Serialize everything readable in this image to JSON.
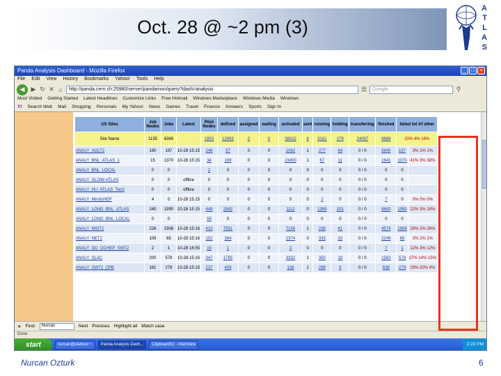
{
  "slide": {
    "title": "Oct. 28 @ ~2 pm (3)",
    "footer": "Nurcan Ozturk",
    "page_number": "6",
    "logo_letters": [
      "A",
      "T",
      "L",
      "A",
      "S"
    ]
  },
  "browser": {
    "window_title": "Panda Analysis Dashboard - Mozilla Firefox",
    "menu": [
      "File",
      "Edit",
      "View",
      "History",
      "Bookmarks",
      "Yahoo!",
      "Tools",
      "Help"
    ],
    "url": "http://panda.cern.ch:25980/server/pandamon/query?dash=analysis",
    "search_placeholder": "Google",
    "bookmarks": [
      "Most Visited",
      "Getting Started",
      "Latest Headlines",
      "Customize Links",
      "Free Hotmail",
      "Windows Marketplace",
      "Windows Media",
      "Windows"
    ],
    "yahoo_toolbar": [
      "Y!",
      "Search Web",
      "Mail",
      "Shopping",
      "Personals",
      "My Yahoo!",
      "News",
      "Games",
      "Travel",
      "Finance",
      "Answers",
      "Sports",
      "Sign In"
    ]
  },
  "table": {
    "headers": [
      "US Sites",
      "Job Nodes",
      "Jobs",
      "Latest",
      "Pilot Nodes",
      "defined",
      "assigned",
      "waiting",
      "activated",
      "sent",
      "running",
      "holding",
      "transferring",
      "finished",
      "failed tot trf other"
    ],
    "summary": [
      "Site Name",
      "1135",
      "6386",
      "",
      "1993",
      "12963",
      "0",
      "0",
      "38622",
      "6",
      "3161",
      "279",
      "24087",
      "8686",
      "20% 4% 16%"
    ],
    "rows": [
      [
        "ANALY_AGLT2",
        "160",
        "197",
        "10-28 15:15",
        "248",
        "57",
        "0",
        "0",
        "1062",
        "1",
        "277",
        "64",
        "0 / 0",
        "5640",
        "197",
        "3% 1% 1%"
      ],
      [
        "ANALY_BNL_ATLAS_1",
        "15",
        "1370",
        "10-28 15:15",
        "34",
        "199",
        "0",
        "0",
        "23400",
        "1",
        "67",
        "11",
        "0 / 0",
        "1641",
        "1070",
        "41% 3% 38%"
      ],
      [
        "ANALY_BNL_LOCAL",
        "0",
        "0",
        "",
        "2",
        "0",
        "0",
        "0",
        "0",
        "0",
        "0",
        "0",
        "0 / 0",
        "0",
        "0",
        ""
      ],
      [
        "ANALY_GLOW-ATLAS",
        "0",
        "0",
        "offline",
        "0",
        "0",
        "0",
        "0",
        "0",
        "0",
        "0",
        "0",
        "0 / 0",
        "0",
        "0",
        ""
      ],
      [
        "ANALY_HU_ATLAS_Tier2",
        "0",
        "0",
        "offline",
        "0",
        "0",
        "0",
        "0",
        "0",
        "0",
        "0",
        "0",
        "0 / 0",
        "0",
        "0",
        ""
      ],
      [
        "ANALY_IllinoisHEP",
        "4",
        "0",
        "10-28 15:15",
        "0",
        "0",
        "0",
        "0",
        "0",
        "0",
        "2",
        "0",
        "0 / 0",
        "7",
        "0",
        "0% 0% 0%"
      ],
      [
        "ANALY_LONG_BNL_ATLAS",
        "240",
        "1990",
        "10-28 15:15",
        "445",
        "2582",
        "0",
        "0",
        "1112",
        "0",
        "1385",
        "201",
        "0 / 0",
        "8600",
        "1990",
        "22% 3% 19%"
      ],
      [
        "ANALY_LONG_BNL_LOCAL",
        "0",
        "0",
        "",
        "59",
        "0",
        "0",
        "0",
        "0",
        "0",
        "0",
        "0",
        "0 / 0",
        "0",
        "0",
        ""
      ],
      [
        "ANALY_MWT2",
        "226",
        "1908",
        "10-28 15:16",
        "415",
        "7551",
        "0",
        "0",
        "7156",
        "1",
        "236",
        "41",
        "0 / 0",
        "4574",
        "1908",
        "29% 2% 26%"
      ],
      [
        "ANALY_NET2",
        "109",
        "65",
        "10-28 15:16",
        "152",
        "384",
        "0",
        "0",
        "2374",
        "0",
        "333",
        "33",
        "0 / 0",
        "2249",
        "65",
        "3% 2% 1%"
      ],
      [
        "ANALY_OU_OCHEP_SWT2",
        "2",
        "1",
        "10-28 16:55",
        "15",
        "1",
        "0",
        "0",
        "2",
        "0",
        "0",
        "0",
        "0 / 0",
        "7",
        "1",
        "12% 3% 12%"
      ],
      [
        "ANALY_SLAC",
        "200",
        "578",
        "10-28 15:16",
        "347",
        "1785",
        "0",
        "0",
        "3332",
        "1",
        "350",
        "18",
        "0 / 0",
        "1583",
        "578",
        "27% 14% 13%"
      ],
      [
        "ANALY_SWT2_CPB",
        "181",
        "279",
        "10-28 15:15",
        "237",
        "409",
        "0",
        "0",
        "136",
        "1",
        "298",
        "8",
        "0 / 0",
        "638",
        "279",
        "29% 20% 9%"
      ]
    ]
  },
  "findbar": {
    "label": "Find:",
    "value": "Nurcan",
    "previous": "Previous",
    "next": "Next",
    "highlight": "Highlight all",
    "match_case": "Match case"
  },
  "status": {
    "text": "Done"
  },
  "taskbar": {
    "start": "start",
    "items": [
      "nurcan@utahcor:~",
      "Panda Analysis Dash...",
      "Clipboard02 - IrfanView"
    ],
    "clock": "2:23 PM"
  },
  "colors": {
    "highlight": "#e8331e",
    "header": "#8fb0df",
    "summary_row": "#f3f38a"
  }
}
